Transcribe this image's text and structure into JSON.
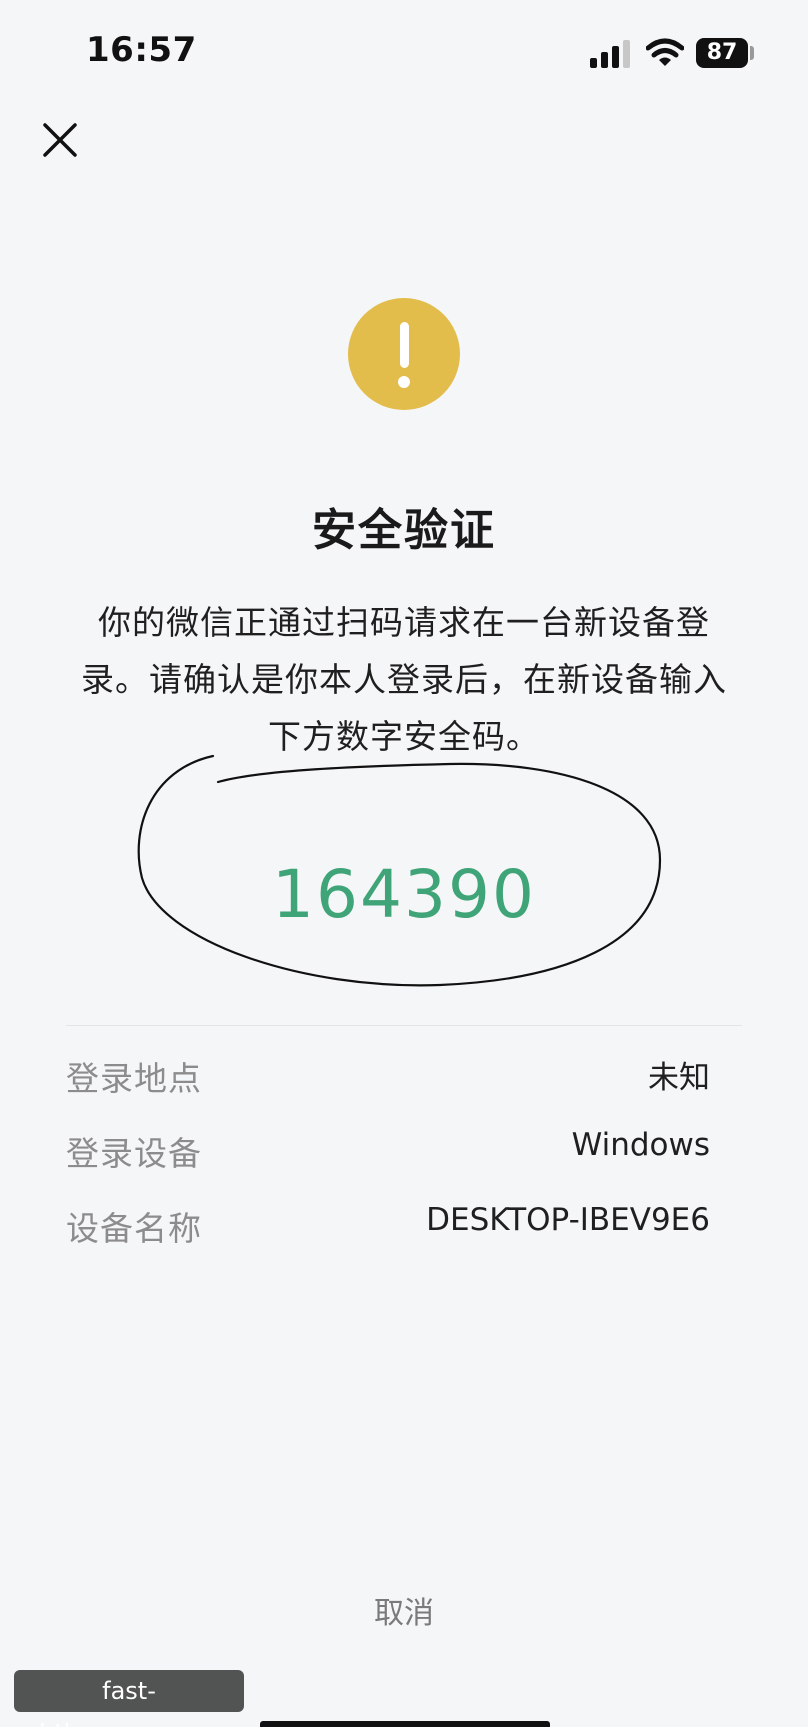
{
  "status_bar": {
    "time": "16:57",
    "battery_level": "87",
    "icons": [
      "signal-icon",
      "wifi-icon",
      "battery-icon"
    ]
  },
  "header": {
    "close_icon": "close-icon"
  },
  "warning": {
    "icon": "exclamation-icon",
    "color": "#e2bd4b"
  },
  "title": "安全验证",
  "description": "你的微信正通过扫码请求在一台新设备登录。请确认是你本人登录后，在新设备输入下方数字安全码。",
  "security_code": "164390",
  "security_code_color": "#3fa477",
  "details": [
    {
      "label": "登录地点",
      "value": "未知"
    },
    {
      "label": "登录设备",
      "value": "Windows"
    },
    {
      "label": "设备名称",
      "value": "DESKTOP-IBEV9E6"
    }
  ],
  "cancel_label": "取消",
  "watermark": "fast-hthapp.com.cn"
}
